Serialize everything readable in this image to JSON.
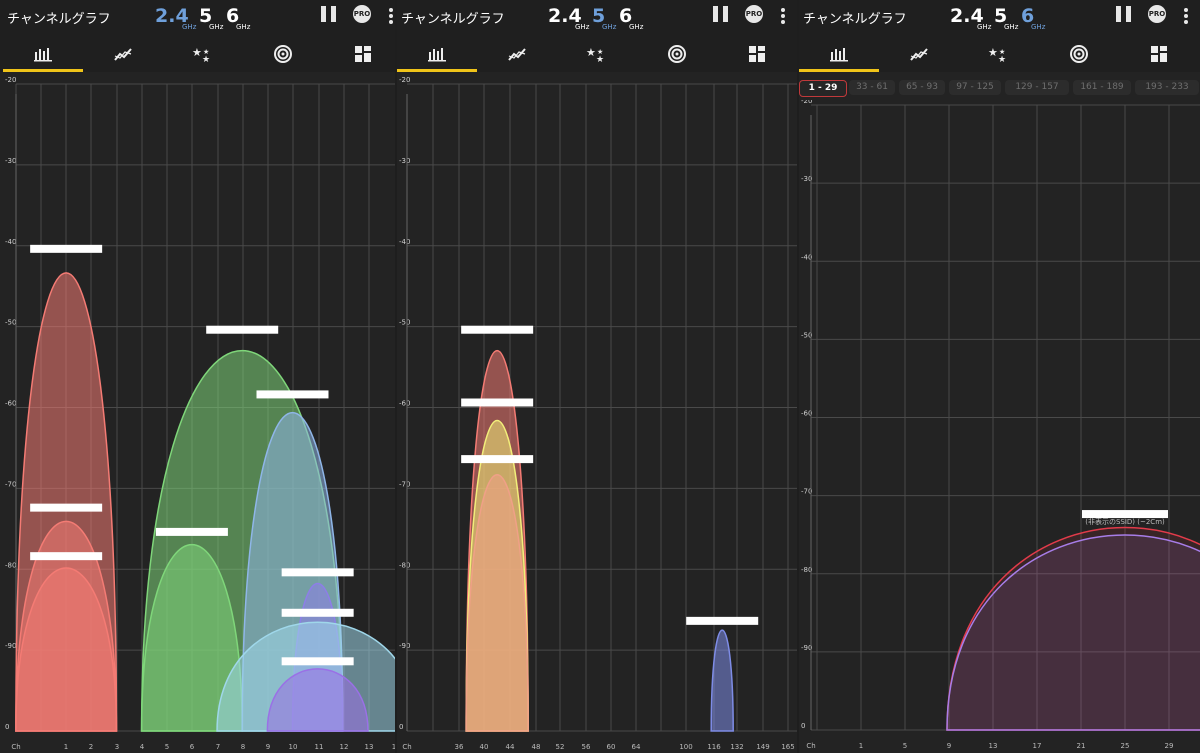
{
  "panels": [
    {
      "app_title": "チャンネルグラフ",
      "bands": [
        {
          "label": "2.4",
          "unit": "GHz",
          "selected": true
        },
        {
          "label": "5",
          "unit": "GHz",
          "selected": false
        },
        {
          "label": "6",
          "unit": "GHz",
          "selected": false
        }
      ],
      "pro_label": "PRO",
      "active_tab": 0,
      "chart_data": {
        "type": "area",
        "x_axis_label": "Ch",
        "x_ticks": [
          "1",
          "2",
          "3",
          "4",
          "5",
          "6",
          "7",
          "8",
          "9",
          "10",
          "11",
          "12",
          "13",
          "1"
        ],
        "y_ticks": [
          "-20",
          "-30",
          "-40",
          "-50",
          "-60",
          "-70",
          "-80",
          "-90",
          "0"
        ],
        "ylim": [
          -100,
          -20
        ],
        "series": [
          {
            "center": 1,
            "half_width": 2,
            "level": -41,
            "color": "#f47b74"
          },
          {
            "center": 1,
            "half_width": 2,
            "level": -73,
            "color": "#f47b74"
          },
          {
            "center": 1,
            "half_width": 2,
            "level": -79,
            "color": "#f47b74"
          },
          {
            "center": 8,
            "half_width": 4,
            "level": -51,
            "color": "#7fd67a"
          },
          {
            "center": 6,
            "half_width": 2,
            "level": -76,
            "color": "#7fd67a"
          },
          {
            "center": 10,
            "half_width": 2,
            "level": -59,
            "color": "#8fb6e8"
          },
          {
            "center": 11,
            "half_width": 1,
            "level": -81,
            "color": "#8d7ee8"
          },
          {
            "center": 11,
            "half_width": 4,
            "level": -86,
            "color": "#9fd7ea"
          },
          {
            "center": 11,
            "half_width": 2,
            "level": -92,
            "color": "#9a70e6"
          }
        ]
      }
    },
    {
      "app_title": "チャンネルグラフ",
      "bands": [
        {
          "label": "2.4",
          "unit": "GHz",
          "selected": false
        },
        {
          "label": "5",
          "unit": "GHz",
          "selected": true
        },
        {
          "label": "6",
          "unit": "GHz",
          "selected": false
        }
      ],
      "pro_label": "PRO",
      "active_tab": 0,
      "chart_data": {
        "type": "area",
        "x_axis_label": "Ch",
        "x_ticks": [
          "36",
          "40",
          "44",
          "48",
          "52",
          "56",
          "60",
          "64",
          "100",
          "116",
          "132",
          "149",
          "165"
        ],
        "y_ticks": [
          "-20",
          "-30",
          "-40",
          "-50",
          "-60",
          "-70",
          "-80",
          "-90",
          "0"
        ],
        "ylim": [
          -100,
          -20
        ],
        "series": [
          {
            "center": 42,
            "level": -51,
            "color": "#f47b74"
          },
          {
            "center": 42,
            "level": -60,
            "color": "#f2ee7a"
          },
          {
            "center": 42,
            "level": -67,
            "color": "#f0a087"
          },
          {
            "center": 122,
            "level": -87,
            "color": "#7e8ce6"
          }
        ]
      }
    },
    {
      "app_title": "チャンネルグラフ",
      "bands": [
        {
          "label": "2.4",
          "unit": "GHz",
          "selected": false
        },
        {
          "label": "5",
          "unit": "GHz",
          "selected": false
        },
        {
          "label": "6",
          "unit": "GHz",
          "selected": true
        }
      ],
      "pro_label": "PRO",
      "active_tab": 0,
      "ranges": [
        "1 - 29",
        "33 - 61",
        "65 - 93",
        "97 - 125",
        "129 - 157",
        "161 - 189",
        "193 - 233"
      ],
      "selected_range": 0,
      "chart_data": {
        "type": "area",
        "x_axis_label": "Ch",
        "x_ticks": [
          "1",
          "5",
          "9",
          "13",
          "17",
          "21",
          "25",
          "29"
        ],
        "y_ticks": [
          "-20",
          "-30",
          "-40",
          "-50",
          "-60",
          "-70",
          "-80",
          "-90",
          "0"
        ],
        "ylim": [
          -100,
          -20
        ],
        "series": [
          {
            "center": 25,
            "level": -73,
            "color": "#e23b4a",
            "label": "(非表示のSSID) (~2Cm)"
          },
          {
            "center": 25,
            "level": -74,
            "color": "#a77de8"
          }
        ]
      }
    }
  ],
  "tab_icons": [
    "bar-chart-icon",
    "time-graph-icon",
    "star-rating-icon",
    "signal-radar-icon",
    "grid-layout-icon"
  ],
  "colors": {
    "accent": "#f0c419",
    "selected_band": "#6fa0db",
    "background": "#232323",
    "grid": "#4a4a4a"
  }
}
